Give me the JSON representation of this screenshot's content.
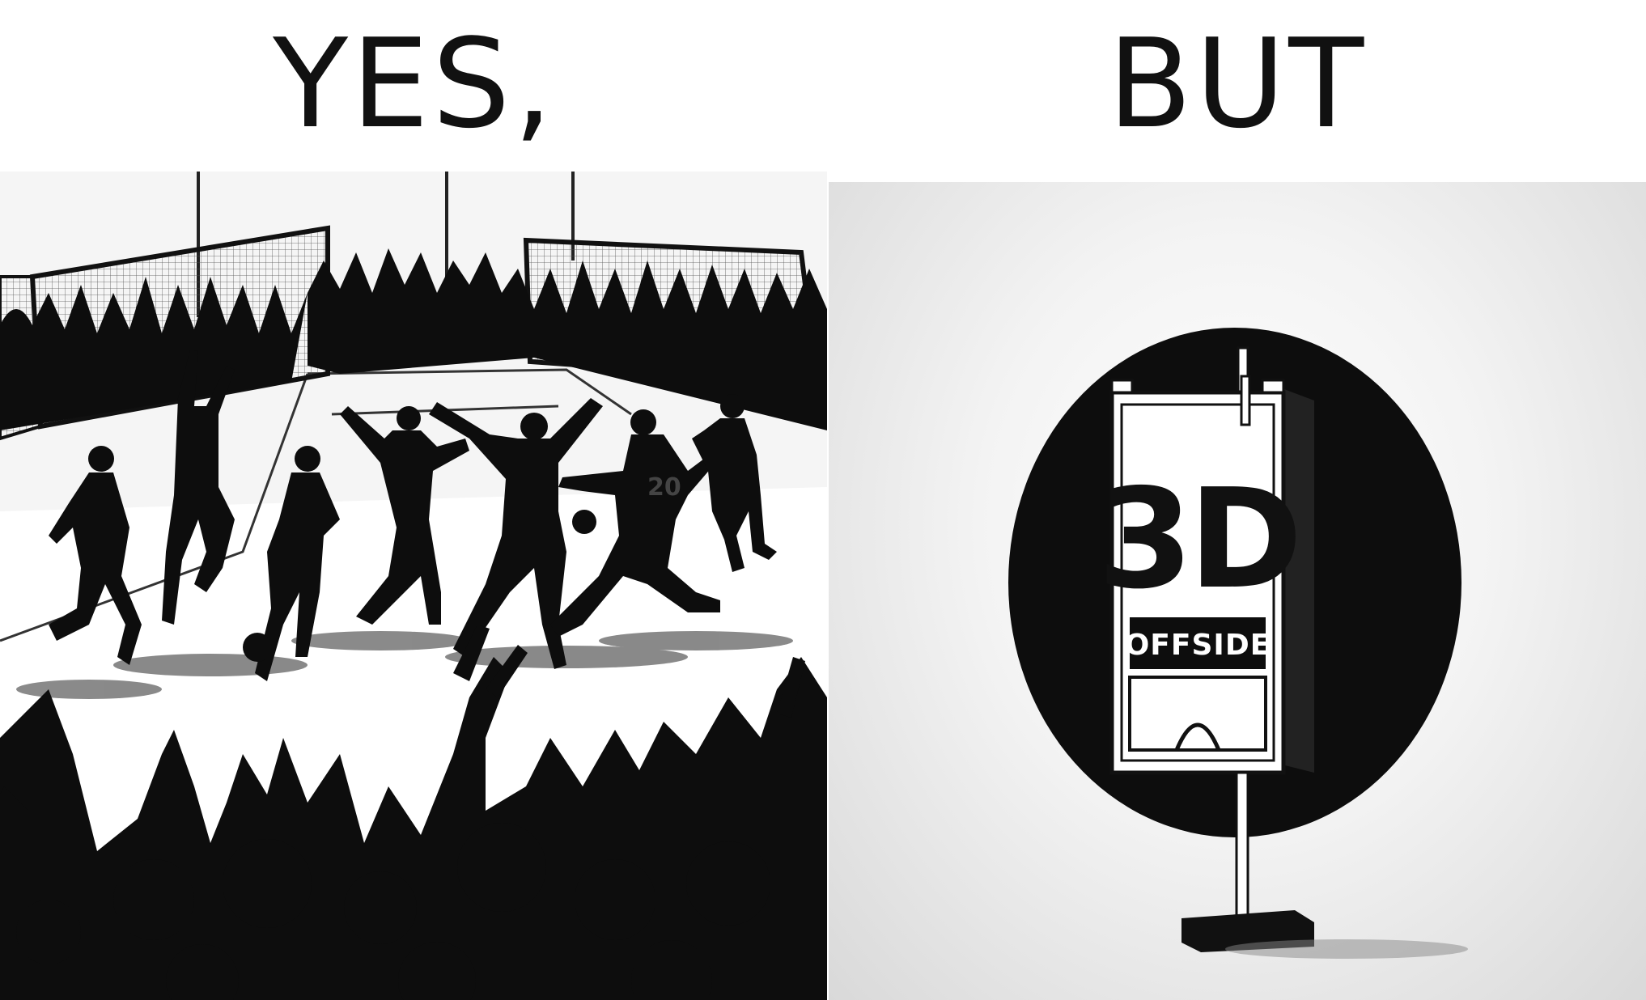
{
  "captions": {
    "left": "YES,",
    "right": "BUT"
  },
  "left_panel": {
    "description_icon": "celebrating-crowd-silhouette-icon",
    "jersey_number": "20"
  },
  "right_panel": {
    "description_icon": "offside-sign-icon",
    "sign_big_text": "3D",
    "sign_label": "OFFSIDE"
  },
  "colors": {
    "silhouette": "#0d0d0d",
    "panel_left_bg": "#f2f2f2",
    "panel_right_bg": "#e6e6e6",
    "sign_white": "#ffffff"
  }
}
